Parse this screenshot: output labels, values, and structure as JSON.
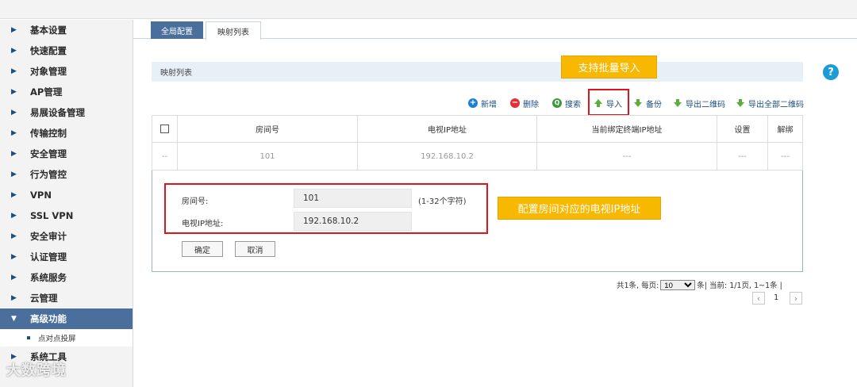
{
  "sidebar": {
    "items": [
      {
        "label": "基本设置"
      },
      {
        "label": "快速配置"
      },
      {
        "label": "对象管理"
      },
      {
        "label": "AP管理"
      },
      {
        "label": "易展设备管理"
      },
      {
        "label": "传输控制"
      },
      {
        "label": "安全管理"
      },
      {
        "label": "行为管控"
      },
      {
        "label": "VPN"
      },
      {
        "label": "SSL VPN"
      },
      {
        "label": "安全审计"
      },
      {
        "label": "认证管理"
      },
      {
        "label": "系统服务"
      },
      {
        "label": "云管理"
      },
      {
        "label": "高级功能",
        "active": true
      }
    ],
    "sub_item": "点对点投屏",
    "last_item": "系统工具"
  },
  "tabs": [
    {
      "label": "全局配置",
      "active": false
    },
    {
      "label": "映射列表",
      "active": true
    }
  ],
  "section_title": "映射列表",
  "help_icon": "?",
  "toolbar": {
    "add": "新增",
    "delete": "删除",
    "search": "搜索",
    "import": "导入",
    "backup": "备份",
    "export_qr": "导出二维码",
    "export_all_qr": "导出全部二维码"
  },
  "callouts": {
    "import": "支持批量导入",
    "config": "配置房间对应的电视IP地址"
  },
  "table": {
    "headers": [
      "房间号",
      "电视IP地址",
      "当前绑定终端IP地址",
      "设置",
      "解绑"
    ],
    "rows": [
      {
        "check": "--",
        "room": "101",
        "tv_ip": "192.168.10.2",
        "terminal_ip": "---",
        "setting": "---",
        "unbind": "---"
      }
    ]
  },
  "form": {
    "room_label": "房间号:",
    "room_value": "101",
    "room_hint": "(1-32个字符)",
    "ip_label": "电视IP地址:",
    "ip_value": "192.168.10.2",
    "confirm": "确定",
    "cancel": "取消"
  },
  "pagination": {
    "total": "共1条,",
    "per_page_label": "每页:",
    "per_page": "10",
    "per_page_unit": "条",
    "current": "| 当前: 1/1页, 1~1条 |",
    "page": "1",
    "prev": "‹",
    "next": "›"
  },
  "watermark": "大数跨境",
  "colors": {
    "accent": "#4a6f9c",
    "callout": "#f8b800",
    "highlight": "#e0141e",
    "help": "#1b9bd8"
  }
}
